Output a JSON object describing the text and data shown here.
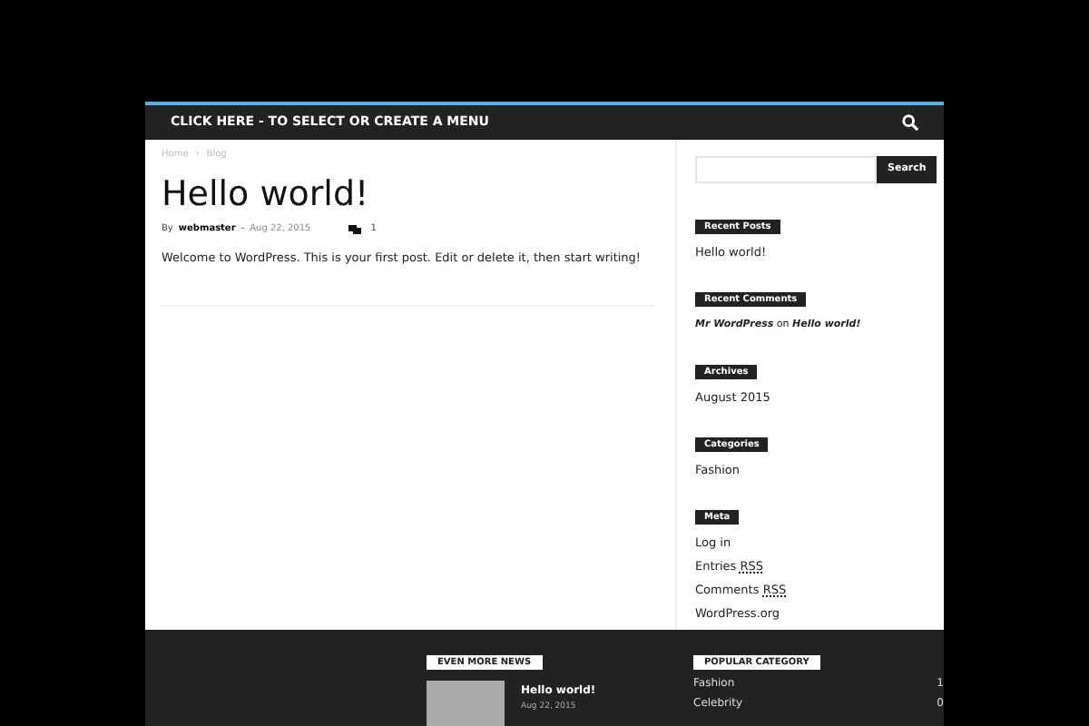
{
  "menu_link": "CLICK HERE - TO SELECT OR CREATE A MENU",
  "breadcrumbs": [
    "Home",
    "Blog"
  ],
  "breadcrumb_separator": "›",
  "post": {
    "title": "Hello world!",
    "by": "By",
    "author": "webmaster",
    "separator": "-",
    "date": "Aug 22, 2015",
    "comments": "1",
    "body": "Welcome to WordPress. This is your first post. Edit or delete it, then start writing!"
  },
  "search": {
    "button": "Search"
  },
  "widgets": [
    {
      "kind": "links",
      "title": "Recent Posts",
      "items": [
        {
          "text": "Hello world!"
        }
      ]
    },
    {
      "kind": "comment",
      "title": "Recent Comments",
      "author": "Mr WordPress",
      "on": "on",
      "post": "Hello world!"
    },
    {
      "kind": "links",
      "title": "Archives",
      "items": [
        {
          "text": "August 2015"
        }
      ]
    },
    {
      "kind": "links",
      "title": "Categories",
      "items": [
        {
          "text": "Fashion"
        }
      ]
    },
    {
      "kind": "links",
      "title": "Meta",
      "items": [
        {
          "text": "Log in"
        },
        {
          "text": "Entries",
          "abbr": "RSS"
        },
        {
          "text": "Comments",
          "abbr": "RSS"
        },
        {
          "text": "WordPress.org"
        }
      ]
    }
  ],
  "footer": {
    "news_title": "EVEN MORE NEWS",
    "news": [
      {
        "title": "Hello world!",
        "date": "Aug 22, 2015"
      }
    ],
    "category_title": "POPULAR CATEGORY",
    "categories": [
      {
        "name": "Fashion",
        "count": "1"
      },
      {
        "name": "Celebrity",
        "count": "0"
      }
    ]
  }
}
